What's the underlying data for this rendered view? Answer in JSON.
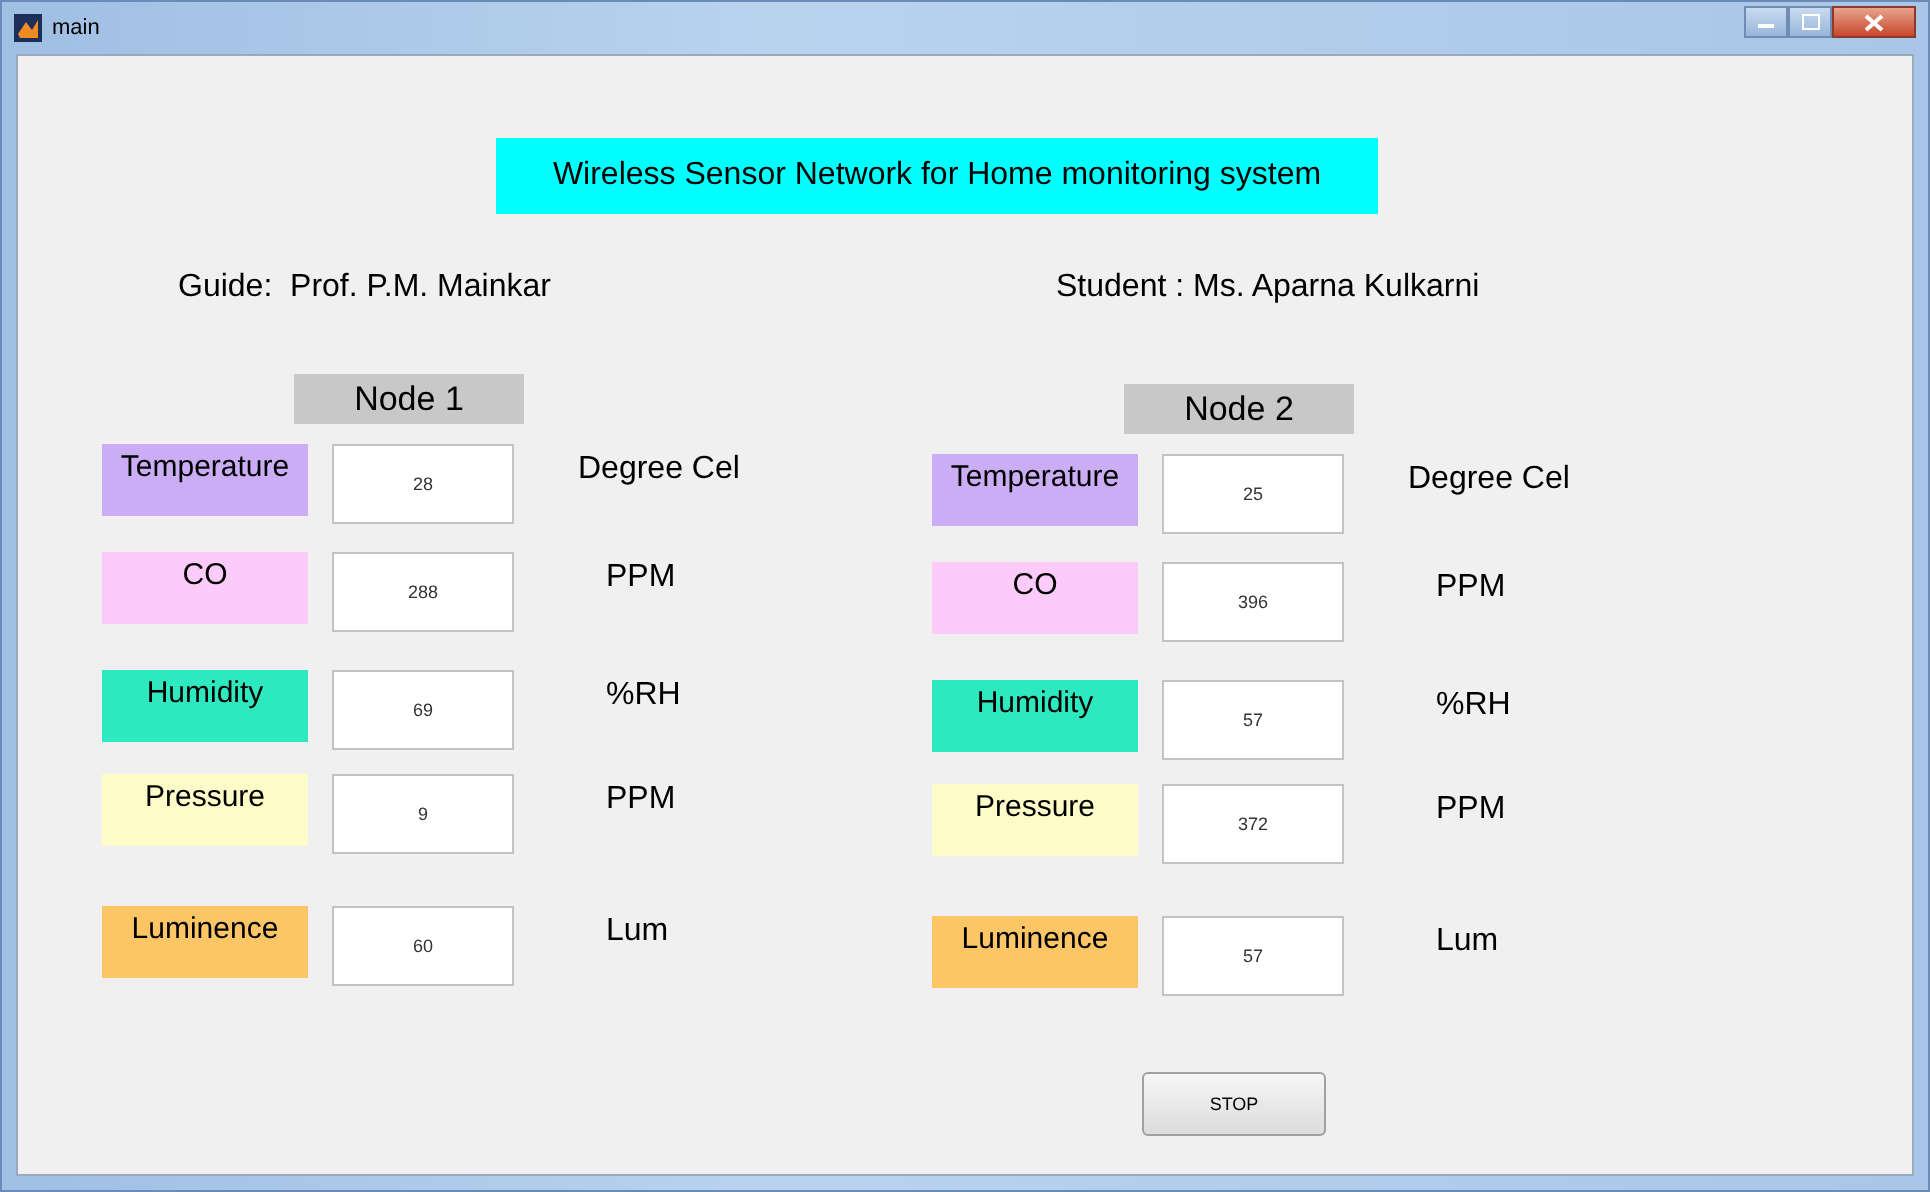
{
  "window": {
    "title": "main"
  },
  "heading": "Wireless Sensor Network for Home monitoring system",
  "guide": "Guide:  Prof. P.M. Mainkar",
  "student": "Student : Ms. Aparna Kulkarni",
  "nodes": [
    {
      "title": "Node 1",
      "readings": [
        {
          "label": "Temperature",
          "color": "#cbadf5",
          "value": "28",
          "unit": "Degree Cel"
        },
        {
          "label": "CO",
          "color": "#fccbfa",
          "value": "288",
          "unit": "PPM"
        },
        {
          "label": "Humidity",
          "color": "#2ee8c0",
          "value": "69",
          "unit": "%RH"
        },
        {
          "label": "Pressure",
          "color": "#fdfcc9",
          "value": "9",
          "unit": "PPM"
        },
        {
          "label": "Luminence",
          "color": "#fcc566",
          "value": "60",
          "unit": "Lum"
        }
      ]
    },
    {
      "title": "Node 2",
      "readings": [
        {
          "label": "Temperature",
          "color": "#cbadf5",
          "value": "25",
          "unit": "Degree Cel"
        },
        {
          "label": "CO",
          "color": "#fccbfa",
          "value": "396",
          "unit": "PPM"
        },
        {
          "label": "Humidity",
          "color": "#2ee8c0",
          "value": "57",
          "unit": "%RH"
        },
        {
          "label": "Pressure",
          "color": "#fdfcc9",
          "value": "372",
          "unit": "PPM"
        },
        {
          "label": "Luminence",
          "color": "#fcc566",
          "value": "57",
          "unit": "Lum"
        }
      ]
    }
  ],
  "stop_button": "STOP"
}
